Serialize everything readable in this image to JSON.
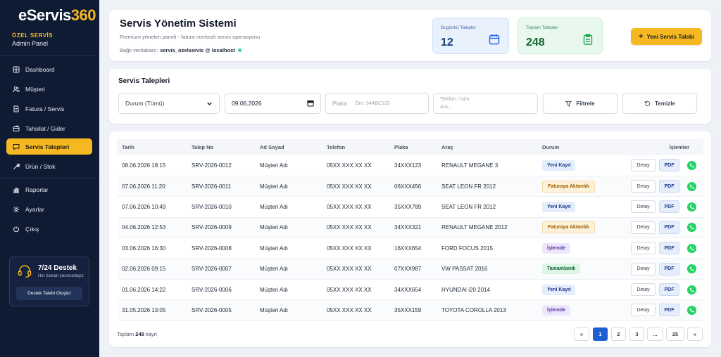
{
  "brand": {
    "logo_main": "eServis",
    "logo_num": "360",
    "role": "ÖZEL SERVİS",
    "panel": "Admin Panel"
  },
  "nav": [
    {
      "label": "Dashboard",
      "icon": "dashboard-icon"
    },
    {
      "label": "Müşteri",
      "icon": "users-icon"
    },
    {
      "label": "Fatura / Servis",
      "icon": "invoice-icon"
    },
    {
      "label": "Tahsilat / Gider",
      "icon": "wallet-icon"
    },
    {
      "label": "Servis Talepleri",
      "icon": "chat-icon",
      "active": true
    },
    {
      "label": "Ürün / Stok",
      "icon": "wrench-icon"
    },
    {
      "label": "Raporlar",
      "icon": "chart-icon"
    },
    {
      "label": "Ayarlar",
      "icon": "gear-icon"
    },
    {
      "label": "Çıkış",
      "icon": "logout-icon"
    }
  ],
  "support": {
    "title": "7/24 Destek",
    "subtitle": "Her zaman yanınızdayız",
    "button": "Destek Talebi Oluştur"
  },
  "header": {
    "title": "Servis Yönetim Sistemi",
    "subtitle": "Premium yönetim paneli - fatura merkezli servis operasyonu",
    "db_label": "Bağlı veritabanı:",
    "db_value": "servis_ozelservis @ localhost",
    "stat_today_label": "Bugünkü Talepler",
    "stat_today_value": "12",
    "stat_total_label": "Toplam Talepler",
    "stat_total_value": "248",
    "new_button": "Yeni Servis Talebi"
  },
  "filters": {
    "title": "Servis Talepleri",
    "status_value": "Durum (Tümü)",
    "date_value": "09.06.2026",
    "plate_label": "Plaka",
    "plate_placeholder": "Örn: 34ABC123",
    "phone_label": "Telefon / İsim",
    "phone_placeholder": "Ara...",
    "filter_button": "Filtrele",
    "clear_button": "Temizle"
  },
  "table": {
    "columns": [
      "Tarih",
      "Talep No",
      "Ad Soyad",
      "Telefon",
      "Plaka",
      "Araç",
      "Durum",
      "İşlemler"
    ],
    "detail_label": "Detay",
    "pdf_label": "PDF",
    "rows": [
      [
        "08.06.2026 18:15",
        "SRV-2026-0012",
        "Müşteri Adı",
        "05XX XXX XX XX",
        "34XXX123",
        "RENAULT MEGANE 3",
        "Yeni Kayıt"
      ],
      [
        "07.06.2026 11:20",
        "SRV-2026-0011",
        "Müşteri Adı",
        "05XX XXX XX XX",
        "06XXX456",
        "SEAT LEON FR 2012",
        "Faturaya Aktarıldı"
      ],
      [
        "07.06.2026 10:49",
        "SRV-2026-0010",
        "Müşteri Adı",
        "05XX XXX XX XX",
        "35XXX789",
        "SEAT LEON FR 2012",
        "Yeni Kayıt"
      ],
      [
        "04.06.2026 12:53",
        "SRV-2026-0009",
        "Müşteri Adı",
        "05XX XXX XX XX",
        "34XXX321",
        "RENAULT MEGANE 2012",
        "Faturaya Aktarıldı"
      ],
      [
        "03.06.2026 16:30",
        "SRV-2026-0008",
        "Müşteri Adı",
        "05XX XXX XX XX",
        "16XXX654",
        "FORD FOCUS 2015",
        "İşlemde"
      ],
      [
        "02.06.2026 09:15",
        "SRV-2026-0007",
        "Müşteri Adı",
        "05XX XXX XX XX",
        "07XXX987",
        "VW PASSAT 2016",
        "Tamamlandı"
      ],
      [
        "01.06.2026 14:22",
        "SRV-2026-0006",
        "Müşteri Adı",
        "05XX XXX XX XX",
        "34XXX654",
        "HYUNDAI i20 2014",
        "Yeni Kayıt"
      ],
      [
        "31.05.2026 13:05",
        "SRV-2026-0005",
        "Müşteri Adı",
        "05XX XXX XX XX",
        "35XXX159",
        "TOYOTA COROLLA 2013",
        "İşlemde"
      ]
    ]
  },
  "footer": {
    "total_prefix": "Toplam",
    "total_value": "248",
    "total_suffix": "kayıt",
    "pages": [
      "«",
      "1",
      "2",
      "3",
      "...",
      "25",
      "»"
    ],
    "active_page": "1"
  },
  "colors": {
    "sidebar": "#0f1b33",
    "accent": "#f5b820",
    "primary": "#1d5fd1",
    "whatsapp": "#25d366"
  }
}
